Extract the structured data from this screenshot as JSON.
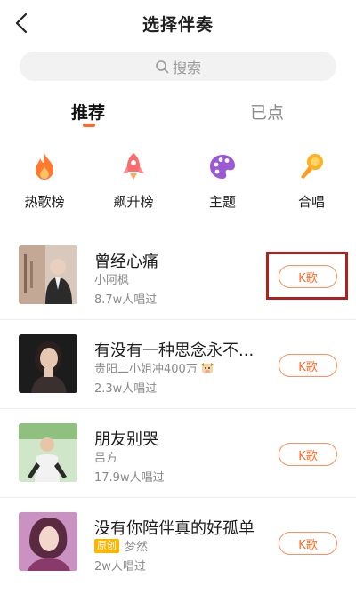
{
  "header": {
    "title": "选择伴奏"
  },
  "search": {
    "placeholder": "搜索"
  },
  "tabs": [
    {
      "label": "推荐",
      "active": true
    },
    {
      "label": "已点",
      "active": false
    }
  ],
  "categories": [
    {
      "label": "热歌榜",
      "icon": "flame-icon",
      "color": "#ff7a2e"
    },
    {
      "label": "飙升榜",
      "icon": "rocket-icon",
      "color": "#ff6a6a"
    },
    {
      "label": "主题",
      "icon": "palette-icon",
      "color": "#9b59d6"
    },
    {
      "label": "合唱",
      "icon": "microphone-icon",
      "color": "#ffb020"
    }
  ],
  "songs": [
    {
      "title": "曾经心痛",
      "artist": "小阿枫",
      "count": "8.7w人唱过",
      "button": "K歌",
      "highlighted": true
    },
    {
      "title": "有没有一种思念永不...",
      "artist": "贵阳二小姐冲400万",
      "count": "2.3w人唱过",
      "button": "K歌",
      "emoji": true
    },
    {
      "title": "朋友别哭",
      "artist": "吕方",
      "count": "17.9w人唱过",
      "button": "K歌"
    },
    {
      "title": "没有你陪伴真的好孤单",
      "artist": "梦然",
      "badge": "原创",
      "count": "2w人唱过",
      "button": "K歌"
    }
  ],
  "accent_color": "#ff6a2a",
  "highlight_color": "#b0201e"
}
